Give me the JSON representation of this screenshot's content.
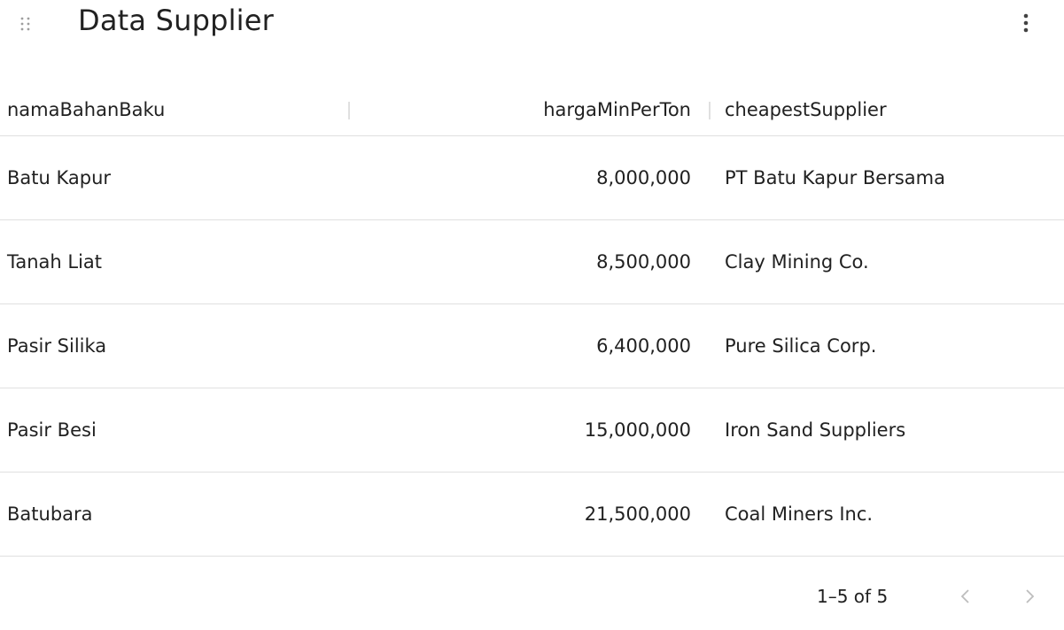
{
  "header": {
    "title": "Data Supplier",
    "drag_icon": "drag-handle-icon",
    "menu_icon": "more-vert-icon"
  },
  "table": {
    "columns": [
      "namaBahanBaku",
      "hargaMinPerTon",
      "cheapestSupplier"
    ],
    "rows": [
      [
        "Batu Kapur",
        "8,000,000",
        "PT Batu Kapur Bersama"
      ],
      [
        "Tanah Liat",
        "8,500,000",
        "Clay Mining Co."
      ],
      [
        "Pasir Silika",
        "6,400,000",
        "Pure Silica Corp."
      ],
      [
        "Pasir Besi",
        "15,000,000",
        "Iron Sand Suppliers"
      ],
      [
        "Batubara",
        "21,500,000",
        "Coal Miners Inc."
      ]
    ]
  },
  "footer": {
    "range_text": "1–5 of 5",
    "prev_icon": "chevron-left-icon",
    "next_icon": "chevron-right-icon"
  },
  "colors": {
    "text": "#212121",
    "divider": "#e0e0e0",
    "icon_muted": "#9e9e9e",
    "icon": "#616161"
  }
}
